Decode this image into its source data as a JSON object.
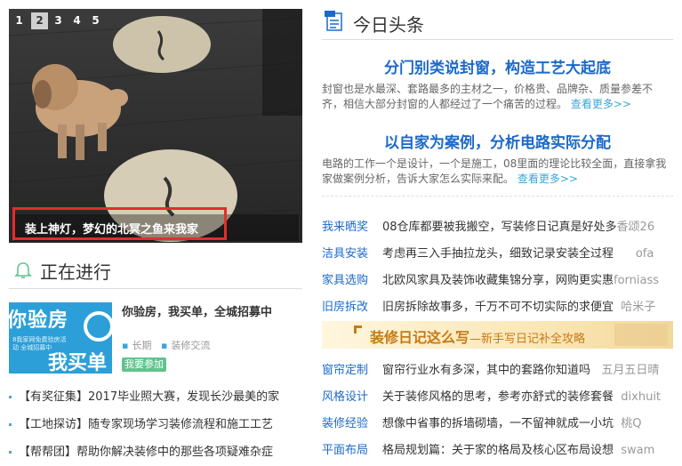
{
  "carousel": {
    "pages": [
      "1",
      "2",
      "3",
      "4",
      "5"
    ],
    "active_index": 1,
    "caption": "装上神灯，梦幻的北冥之鱼来我家"
  },
  "ongoing": {
    "title": "正在进行",
    "promo": {
      "image_text_1": "你验房",
      "image_text_2": "8我家网免费验房活动 全城招募中",
      "image_text_3": "我买单",
      "title": "你验房，我买单，全城招募中",
      "tag1": "长期",
      "tag2": "装修交流",
      "button": "我要参加"
    },
    "items": [
      "【有奖征集】2017毕业照大赛，发现长沙最美的家",
      "【工地探访】随专家现场学习装修流程和施工工艺",
      "【帮帮团】帮助你解决装修中的那些各项疑难杂症"
    ]
  },
  "news": {
    "title": "今日头条",
    "articles": [
      {
        "headline": "分门别类说封窗，构造工艺大起底",
        "desc": "封窗也是水最深、套路最多的主材之一，价格贵、品牌杂、质量参差不齐，相信大部分封窗的人都经过了一个痛苦的过程。",
        "more": "查看更多>>"
      },
      {
        "headline": "以自家为案例，分析电路实际分配",
        "desc": "电路的工作一个是设计，一个是施工，08里面的理论比较全面，直接拿我家做案例分析，告诉大家怎么实际来配。",
        "more": "查看更多>>"
      }
    ],
    "list1": [
      {
        "cat": "我来晒奖",
        "text": "08仓库都要被我搬空，写装修日记真是好处多",
        "user": "香颂26"
      },
      {
        "cat": "洁具安装",
        "text": "考虑再三入手抽拉龙头，细致记录安装全过程",
        "user": "ofa"
      },
      {
        "cat": "家具选购",
        "text": "北欧风家具及装饰收藏集锦分享，网购更实惠",
        "user": "forniass"
      },
      {
        "cat": "旧房拆改",
        "text": "旧房拆除故事多，千万不可不切实际的求便宜",
        "user": "哈米子"
      }
    ],
    "banner": {
      "title": "装修日记这么写",
      "subtitle": "—新手写日记补全攻略"
    },
    "list2": [
      {
        "cat": "窗帘定制",
        "text": "窗帘行业水有多深，其中的套路你知道吗",
        "user": "五月五日晴"
      },
      {
        "cat": "风格设计",
        "text": "关于装修风格的思考，参考亦舒式的装修套餐",
        "user": "dixhuit"
      },
      {
        "cat": "装修经验",
        "text": "想像中省事的拆墙砌墙，一不留神就成一小坑",
        "user": "桃Q"
      },
      {
        "cat": "平面布局",
        "text": "格局规划篇：关于家的格局及核心区布局设想",
        "user": "swam"
      }
    ]
  }
}
